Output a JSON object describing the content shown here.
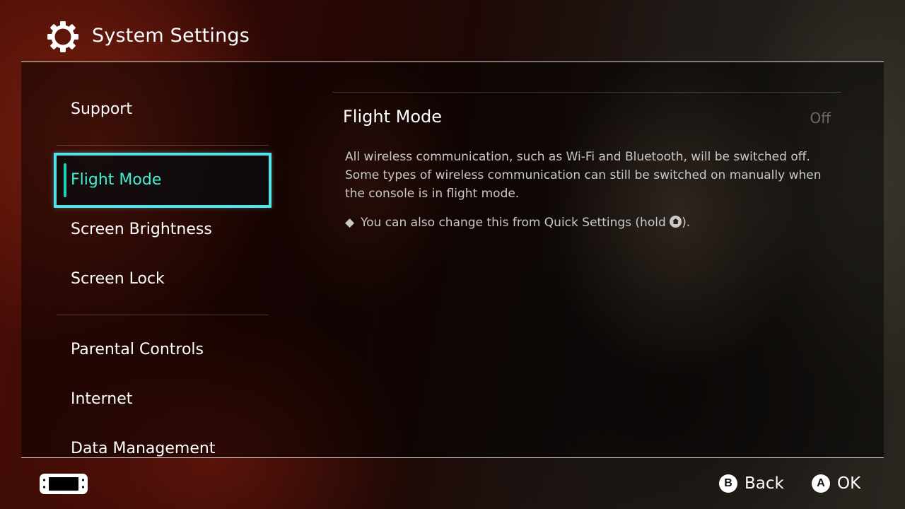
{
  "header": {
    "title": "System Settings",
    "icon": "gear-icon"
  },
  "sidebar": {
    "items": [
      {
        "label": "Support"
      },
      {
        "label": "Flight Mode",
        "selected": true
      },
      {
        "label": "Screen Brightness"
      },
      {
        "label": "Screen Lock"
      },
      {
        "label": "Parental Controls"
      },
      {
        "label": "Internet"
      },
      {
        "label": "Data Management"
      }
    ]
  },
  "content": {
    "setting_title": "Flight Mode",
    "setting_value": "Off",
    "description": "All wireless communication, such as Wi-Fi and Bluetooth, will be switched off. Some types of wireless communication can still be switched on manually when the console is in flight mode.",
    "note_bullet": "◆",
    "note_prefix": "You can also change this from Quick Settings (hold ",
    "note_suffix": ")."
  },
  "footer": {
    "console_icon": "console-icon",
    "back_button": {
      "glyph": "B",
      "label": "Back"
    },
    "ok_button": {
      "glyph": "A",
      "label": "OK"
    }
  },
  "colors": {
    "selection_border": "#55e3e8",
    "selection_text": "#3cf0d6",
    "text_primary": "#ffffff",
    "text_secondary": "#c9c9c9",
    "value_dim": "#5a5a5a"
  }
}
